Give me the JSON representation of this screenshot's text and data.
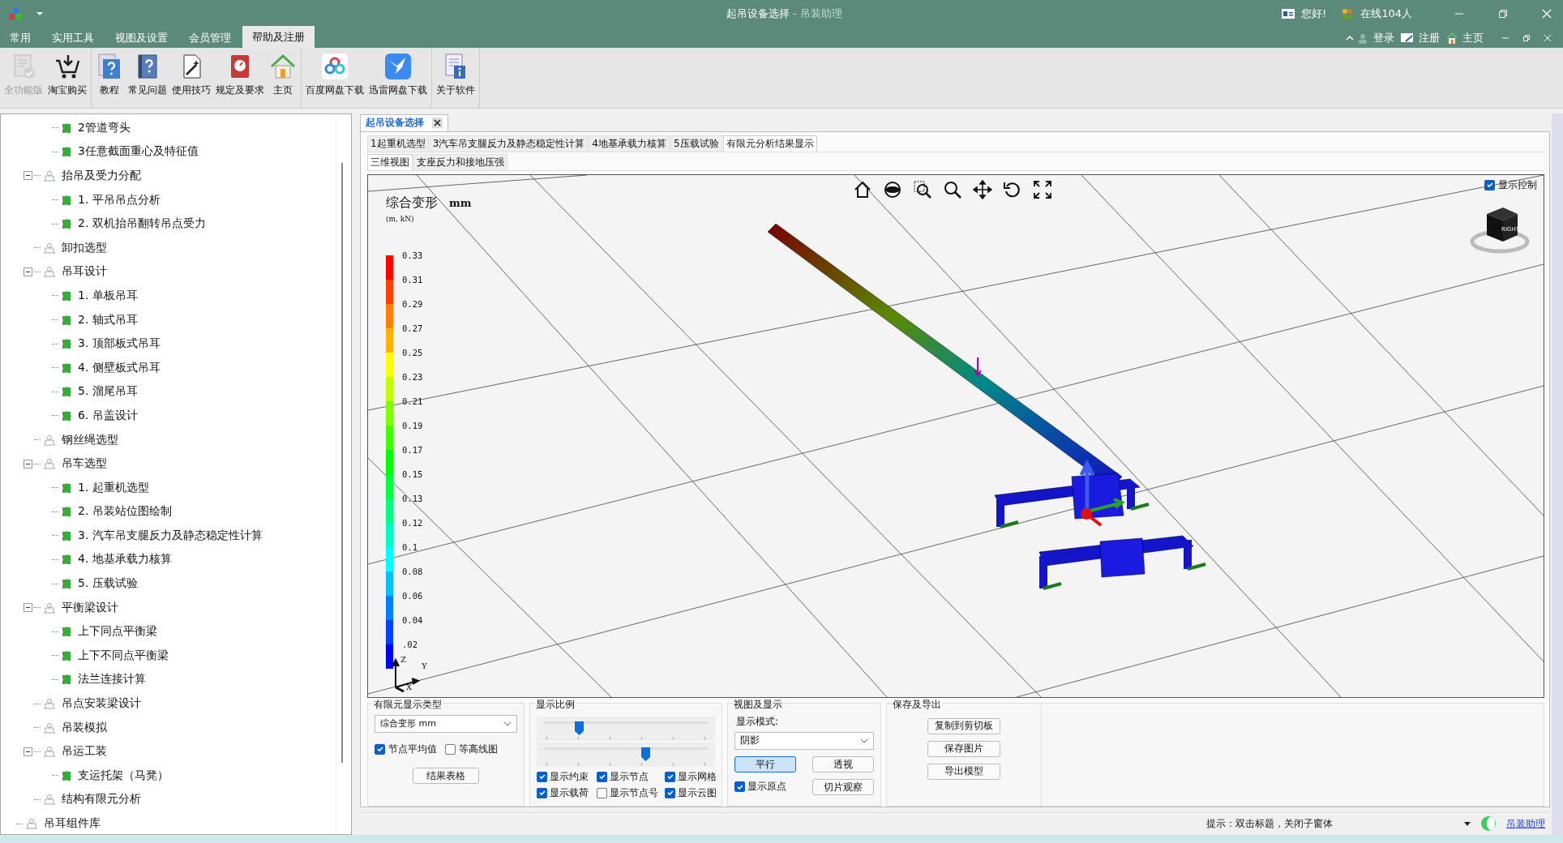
{
  "window": {
    "title": "起吊设备选择",
    "app_name": "- 吊装助理",
    "greeting": "您好!",
    "online": "在线104人"
  },
  "menu_tabs": [
    {
      "label": "常用",
      "selected": false
    },
    {
      "label": "实用工具",
      "selected": false
    },
    {
      "label": "视图及设置",
      "selected": false
    },
    {
      "label": "会员管理",
      "selected": false
    },
    {
      "label": "帮助及注册",
      "selected": true
    }
  ],
  "account_links": [
    "登录",
    "注册",
    "主页"
  ],
  "ribbon_groups": [
    {
      "buttons": [
        {
          "label": "全功能版",
          "kind": "license",
          "disabled": true
        },
        {
          "label": "淘宝购买",
          "kind": "cart",
          "disabled": false
        }
      ]
    },
    {
      "buttons": [
        {
          "label": "教程",
          "kind": "help",
          "disabled": false
        },
        {
          "label": "常见问题",
          "kind": "faq",
          "disabled": false
        },
        {
          "label": "使用技巧",
          "kind": "wand",
          "disabled": false
        },
        {
          "label": "规定及要求",
          "kind": "manual",
          "disabled": false
        },
        {
          "label": "主页",
          "kind": "home",
          "disabled": false
        }
      ]
    },
    {
      "buttons": [
        {
          "label": "百度网盘下载",
          "kind": "cloud",
          "disabled": false
        },
        {
          "label": "迅雷网盘下载",
          "kind": "bird",
          "disabled": false
        }
      ]
    },
    {
      "buttons": [
        {
          "label": "关于软件",
          "kind": "about",
          "disabled": false
        }
      ]
    }
  ],
  "tree": [
    {
      "children": [
        {
          "children": [
            {
              "label": "2管道弯头"
            },
            {
              "label": "3任意截面重心及特征值"
            }
          ]
        },
        {
          "label": "抬吊及受力分配",
          "expanded": true,
          "children": [
            {
              "label": "1. 平吊吊点分析"
            },
            {
              "label": "2. 双机抬吊翻转吊点受力"
            }
          ]
        },
        {
          "label": "卸扣选型"
        },
        {
          "label": "吊耳设计",
          "expanded": true,
          "children": [
            {
              "label": "1. 单板吊耳"
            },
            {
              "label": "2. 轴式吊耳"
            },
            {
              "label": "3. 顶部板式吊耳"
            },
            {
              "label": "4. 侧壁板式吊耳"
            },
            {
              "label": "5. 溜尾吊耳"
            },
            {
              "label": "6. 吊盖设计"
            }
          ]
        },
        {
          "label": "钢丝绳选型"
        },
        {
          "label": "吊车选型",
          "expanded": true,
          "children": [
            {
              "label": "1. 起重机选型"
            },
            {
              "label": "2. 吊装站位图绘制"
            },
            {
              "label": "3. 汽车吊支腿反力及静态稳定性计算"
            },
            {
              "label": "4. 地基承载力核算"
            },
            {
              "label": "5. 压载试验"
            }
          ]
        },
        {
          "label": "平衡梁设计",
          "expanded": true,
          "children": [
            {
              "label": "上下同点平衡梁"
            },
            {
              "label": "上下不同点平衡梁"
            },
            {
              "label": "法兰连接计算"
            }
          ]
        },
        {
          "label": "吊点安装梁设计"
        },
        {
          "label": "吊装模拟"
        },
        {
          "label": "吊运工装",
          "expanded": true,
          "children": [
            {
              "label": "支运托架（马凳）"
            }
          ]
        },
        {
          "label": "结构有限元分析"
        }
      ]
    },
    {
      "label": "吊耳组件库"
    }
  ],
  "document_tab": {
    "label": "起吊设备选择"
  },
  "function_tabs": [
    {
      "label": "1起重机选型",
      "selected": false
    },
    {
      "label": "3汽车吊支腿反力及静态稳定性计算",
      "selected": false
    },
    {
      "label": "4地基承载力核算",
      "selected": false
    },
    {
      "label": "5压载试验",
      "selected": false
    },
    {
      "label": "有限元分析结果显示",
      "selected": true
    }
  ],
  "view_tabs": [
    {
      "label": "三维视图",
      "selected": true
    },
    {
      "label": "支座反力和接地压强",
      "selected": false
    }
  ],
  "viewport": {
    "legend": {
      "title": "综合变形",
      "unit": "mm",
      "units_note": "(m, kN)",
      "items": [
        {
          "label": "0.33",
          "color": "#ff0000"
        },
        {
          "label": "0.31",
          "color": "#ff4000"
        },
        {
          "label": "0.29",
          "color": "#ff8000"
        },
        {
          "label": "0.27",
          "color": "#ffb000"
        },
        {
          "label": "0.25",
          "color": "#ffff00"
        },
        {
          "label": "0.23",
          "color": "#c0ff00"
        },
        {
          "label": "0.21",
          "color": "#80ff00"
        },
        {
          "label": "0.19",
          "color": "#40ff00"
        },
        {
          "label": "0.17",
          "color": "#00ff00"
        },
        {
          "label": "0.15",
          "color": "#00ff40"
        },
        {
          "label": "0.13",
          "color": "#00ff80"
        },
        {
          "label": "0.12",
          "color": "#00ffc0"
        },
        {
          "label": "0.1",
          "color": "#00ffff"
        },
        {
          "label": "0.08",
          "color": "#00c0ff"
        },
        {
          "label": "0.06",
          "color": "#0080ff"
        },
        {
          "label": "0.04",
          "color": "#0040ff"
        },
        {
          "label": ".02",
          "color": "#0000ff"
        }
      ]
    },
    "display_control": {
      "label": "显示控制",
      "checked": true
    },
    "view_cube_label": "RIGHT",
    "axis_labels": [
      "Z",
      "Y",
      "X"
    ]
  },
  "fe_type_panel": {
    "title": "有限元显示类型",
    "select": "综合变形 mm",
    "options": [
      {
        "label": "节点平均值",
        "checked": true
      },
      {
        "label": "等高线图",
        "checked": false
      }
    ],
    "button": "结果表格"
  },
  "scale_panel": {
    "title": "显示比例",
    "sliders": [
      {
        "level": 0.21
      },
      {
        "level": 0.59
      }
    ],
    "options": [
      {
        "label": "显示约束",
        "checked": true
      },
      {
        "label": "显示节点",
        "checked": true
      },
      {
        "label": "显示网格",
        "checked": true
      },
      {
        "label": "显示载荷",
        "checked": true
      },
      {
        "label": "显示节点号",
        "checked": false
      },
      {
        "label": "显示云图",
        "checked": true
      }
    ]
  },
  "view_panel": {
    "title": "视图及显示",
    "mode_label": "显示模式:",
    "mode": "阴影",
    "projections": [
      {
        "label": "平行",
        "selected": true
      },
      {
        "label": "透视",
        "selected": false
      }
    ],
    "origin": {
      "label": "显示原点",
      "checked": true
    },
    "button": "切片观察"
  },
  "export_panel": {
    "title": "保存及导出",
    "buttons": [
      "复制到剪切板",
      "保存图片",
      "导出模型"
    ]
  },
  "status_bar": {
    "hint": "提示：双击标题，关闭子窗体",
    "link": "吊装助理"
  }
}
